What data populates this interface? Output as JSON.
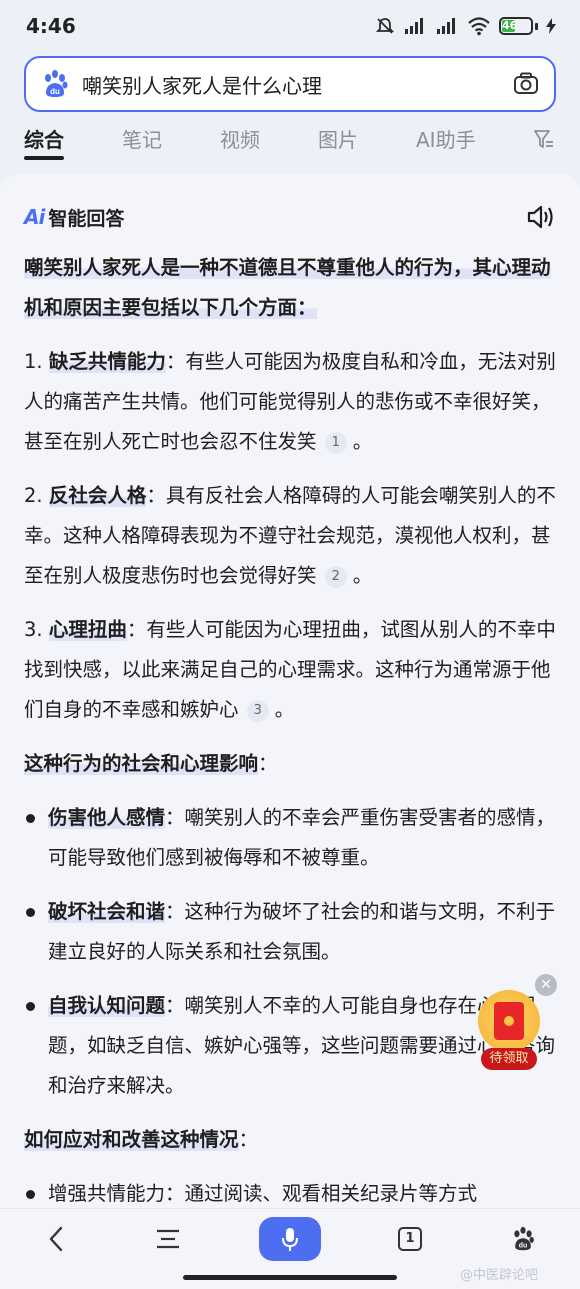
{
  "status_bar": {
    "time": "4:46",
    "battery": "46",
    "battery_level": 0.46
  },
  "search": {
    "query": "嘲笑别人家死人是什么心理"
  },
  "tabs": [
    {
      "label": "综合",
      "active": true
    },
    {
      "label": "笔记",
      "active": false
    },
    {
      "label": "视频",
      "active": false
    },
    {
      "label": "图片",
      "active": false
    },
    {
      "label": "AI助手",
      "active": false
    }
  ],
  "answer": {
    "logo": "Ai",
    "title": "智能回答",
    "intro": "嘲笑别人家死人是一种不道德且不尊重他人的行为，其心理动机和原因主要包括以下几个方面：",
    "points": [
      {
        "num": "1.",
        "title": "缺乏共情能力",
        "text": "：有些人可能因为极度自私和冷血，无法对别人的痛苦产生共情。他们可能觉得别人的悲伤或不幸很好笑，甚至在别人死亡时也会忍不住发笑",
        "cite": "1",
        "end": "。"
      },
      {
        "num": "2.",
        "title": "反社会人格",
        "text": "：具有反社会人格障碍的人可能会嘲笑别人的不幸。这种人格障碍表现为不遵守社会规范，漠视他人权利，甚至在别人极度悲伤时也会觉得好笑",
        "cite": "2",
        "end": "。"
      },
      {
        "num": "3.",
        "title": "心理扭曲",
        "text": "：有些人可能因为心理扭曲，试图从别人的不幸中找到快感，以此来满足自己的心理需求。这种行为通常源于他们自身的不幸感和嫉妒心",
        "cite": "3",
        "end": "。"
      }
    ],
    "impact_title": "这种行为的社会和心理影响",
    "impact_colon": "：",
    "impacts": [
      {
        "title": "伤害他人感情",
        "text": "：嘲笑别人的不幸会严重伤害受害者的感情，可能导致他们感到被侮辱和不被尊重。"
      },
      {
        "title": "破坏社会和谐",
        "text": "：这种行为破坏了社会的和谐与文明，不利于建立良好的人际关系和社会氛围。"
      },
      {
        "title": "自我认知问题",
        "text": "：嘲笑别人不幸的人可能自身也存在心理问题，如缺乏自信、嫉妒心强等，这些问题需要通过心理咨询和治疗来解决。"
      }
    ],
    "improve_title": "如何应对和改善这种情况",
    "improve_colon": "：",
    "cutoff_line": "增强共情能力：通过阅读、观看相关纪录片等方式"
  },
  "red_packet": {
    "label": "待领取"
  },
  "bottom_nav": {
    "tab_count": "1"
  },
  "watermark": "@中医辟论吧"
}
